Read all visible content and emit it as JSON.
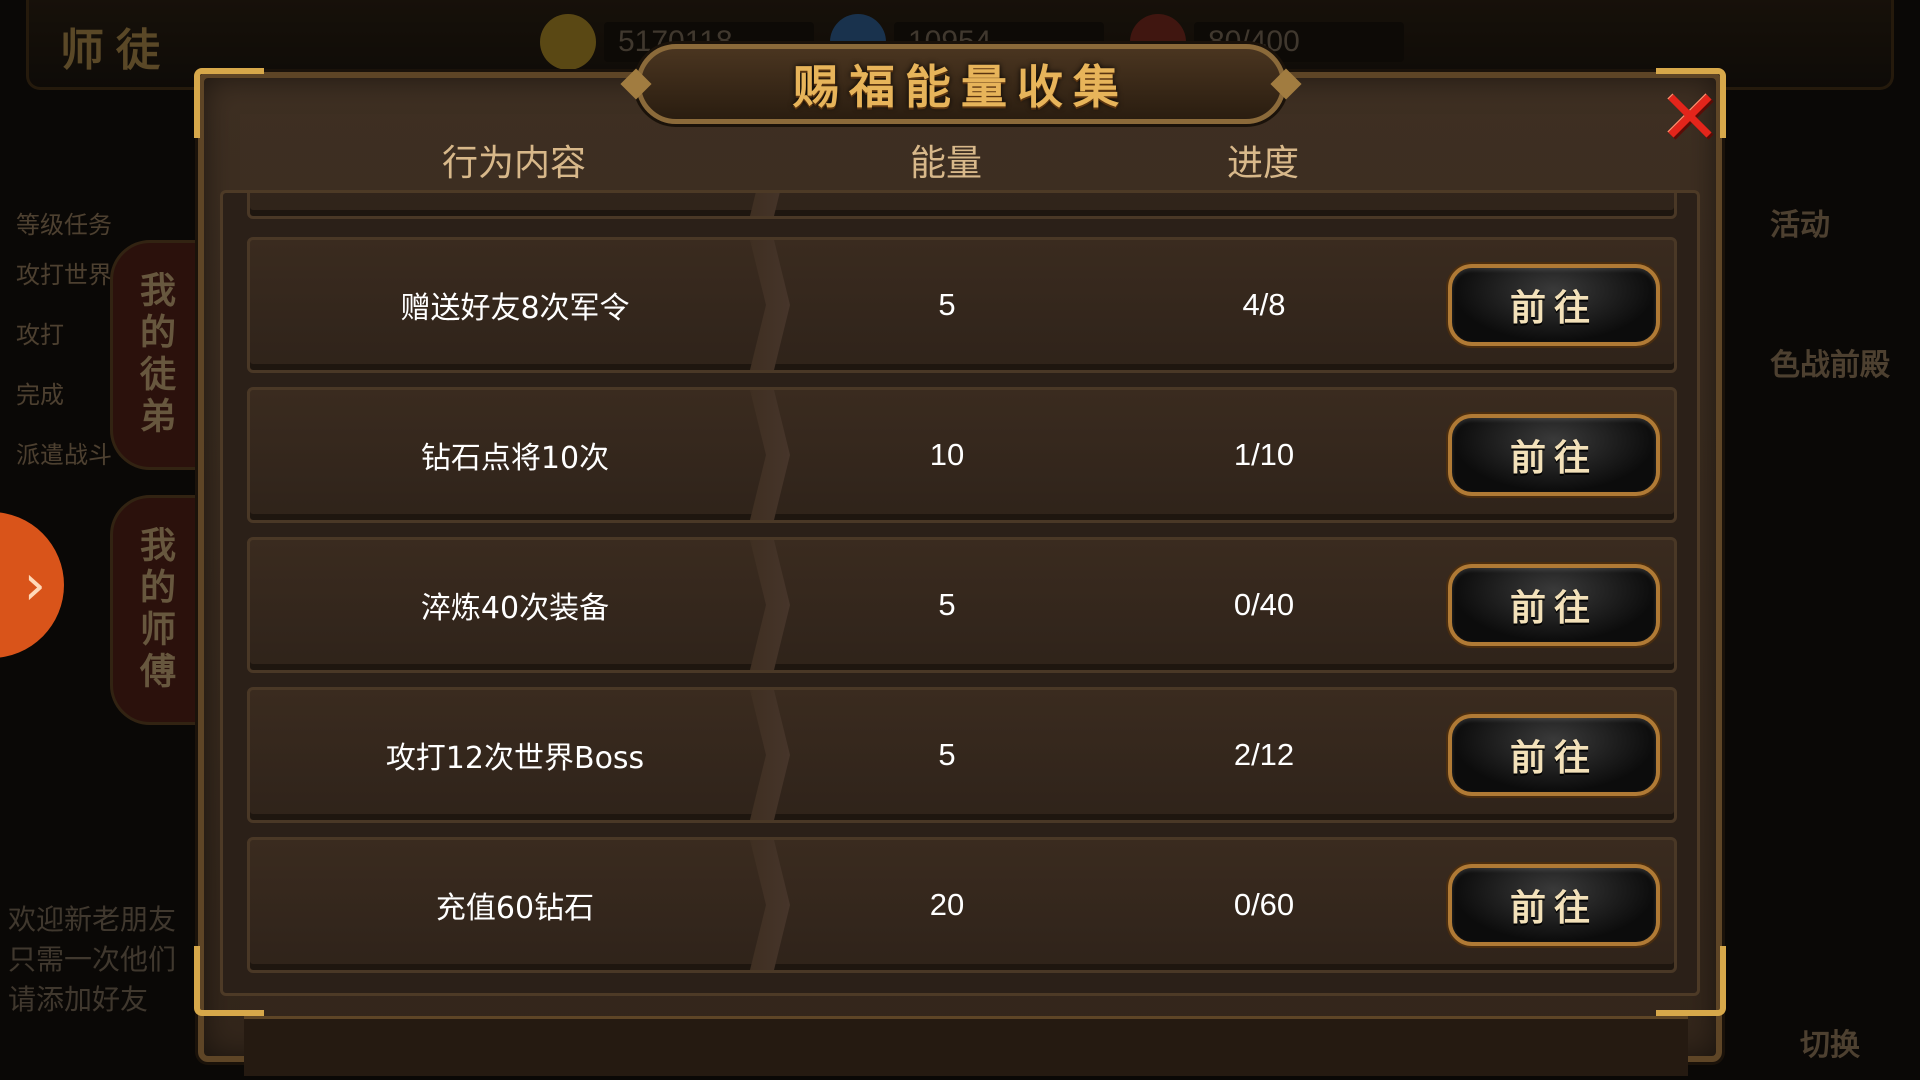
{
  "background": {
    "title": "师徒",
    "resources": [
      {
        "icon": "gold-coin-icon",
        "value": "5170118",
        "color": "#c9a028"
      },
      {
        "icon": "globe-icon",
        "value": "10954",
        "color": "#2f6db0"
      },
      {
        "icon": "stamina-icon",
        "value": "80/400",
        "color": "#8a2a1e"
      }
    ],
    "left_lines": [
      "等级任务",
      "攻打世界",
      "攻打",
      "完成",
      "派遣战斗"
    ],
    "tabs": [
      "我的徒弟",
      "我的师傅"
    ],
    "chat_lines": [
      "欢迎新老朋友",
      "只需一次他们",
      "请添加好友"
    ],
    "right_labels": [
      "活动",
      "色战前殿",
      "切换"
    ]
  },
  "dialog": {
    "title": "赐福能量收集",
    "close_icon": "close-x-icon",
    "columns": {
      "action": "行为内容",
      "energy": "能量",
      "progress": "进度"
    },
    "rows": [
      {
        "action": "赠送好友8次军令",
        "energy": "5",
        "progress": "4/8",
        "button": "前往"
      },
      {
        "action": "钻石点将10次",
        "energy": "10",
        "progress": "1/10",
        "button": "前往"
      },
      {
        "action": "淬炼40次装备",
        "energy": "5",
        "progress": "0/40",
        "button": "前往"
      },
      {
        "action": "攻打12次世界Boss",
        "energy": "5",
        "progress": "2/12",
        "button": "前往"
      },
      {
        "action": "充值60钻石",
        "energy": "20",
        "progress": "0/60",
        "button": "前往"
      }
    ]
  },
  "side_arrow": "›"
}
